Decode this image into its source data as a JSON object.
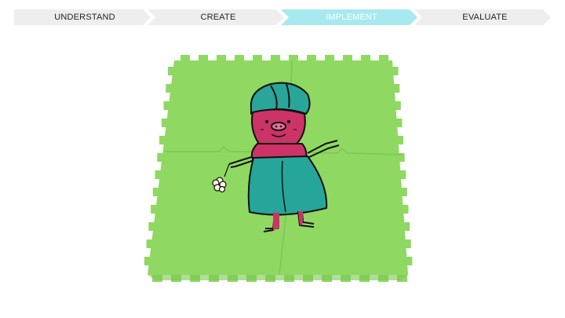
{
  "steps": [
    {
      "label": "UNDERSTAND",
      "active": false
    },
    {
      "label": "CREATE",
      "active": false
    },
    {
      "label": "IMPLEMENT",
      "active": true
    },
    {
      "label": "EVALUATE",
      "active": false
    }
  ],
  "colors": {
    "step_inactive": "#eeeeee",
    "step_active": "#a6e9ee",
    "step_active_text": "#ffffff",
    "mat_green": "#8fd862",
    "mat_shadow": "#7cc653",
    "turban_teal": "#2aa59a",
    "pink": "#cc3366",
    "skirt_teal": "#26a69a"
  },
  "photo": {
    "subject": "green foam puzzle mat with drawing of pig figure"
  }
}
